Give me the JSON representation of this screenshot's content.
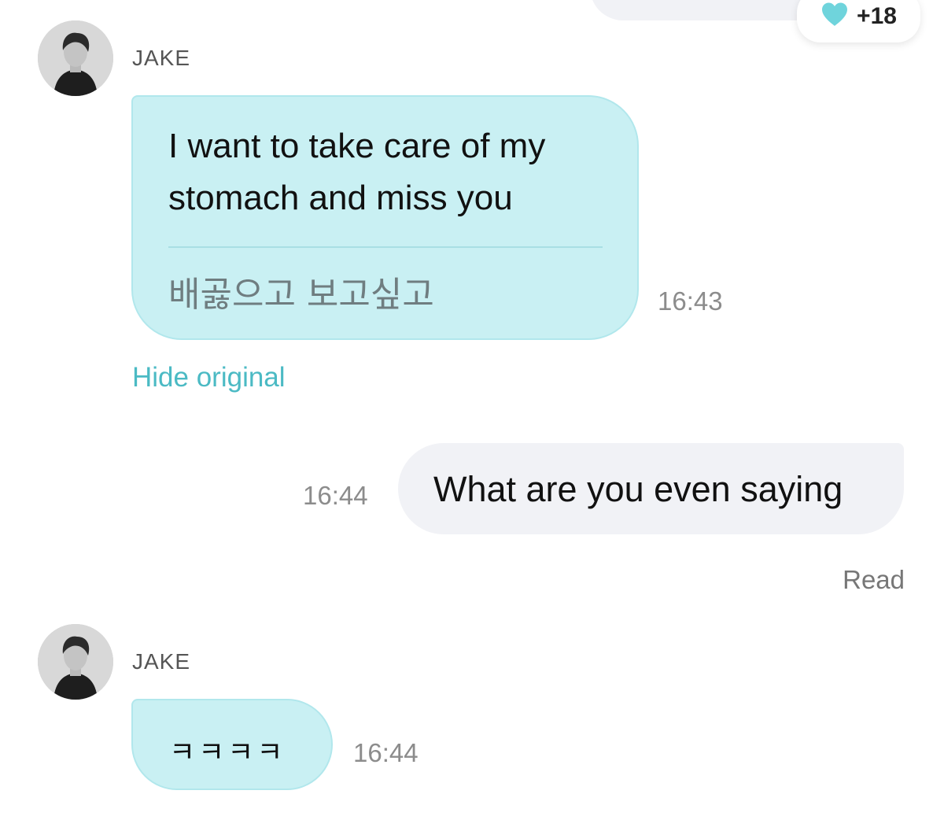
{
  "reaction": {
    "icon": "heart-icon",
    "color": "#6fd4dc",
    "count": "+18"
  },
  "messages": [
    {
      "sender": "JAKE",
      "translated": "I want to take care of my stomach and miss you",
      "original": "배곯으고 보고싶고",
      "time": "16:43",
      "toggle_label": "Hide original"
    },
    {
      "text": "What are you even saying",
      "time": "16:44",
      "status": "Read"
    },
    {
      "sender": "JAKE",
      "text": "ㅋㅋㅋㅋ",
      "time": "16:44"
    }
  ],
  "colors": {
    "incoming_bubble": "#c9f0f3",
    "outgoing_bubble": "#f1f2f6",
    "link": "#4bbac4"
  }
}
